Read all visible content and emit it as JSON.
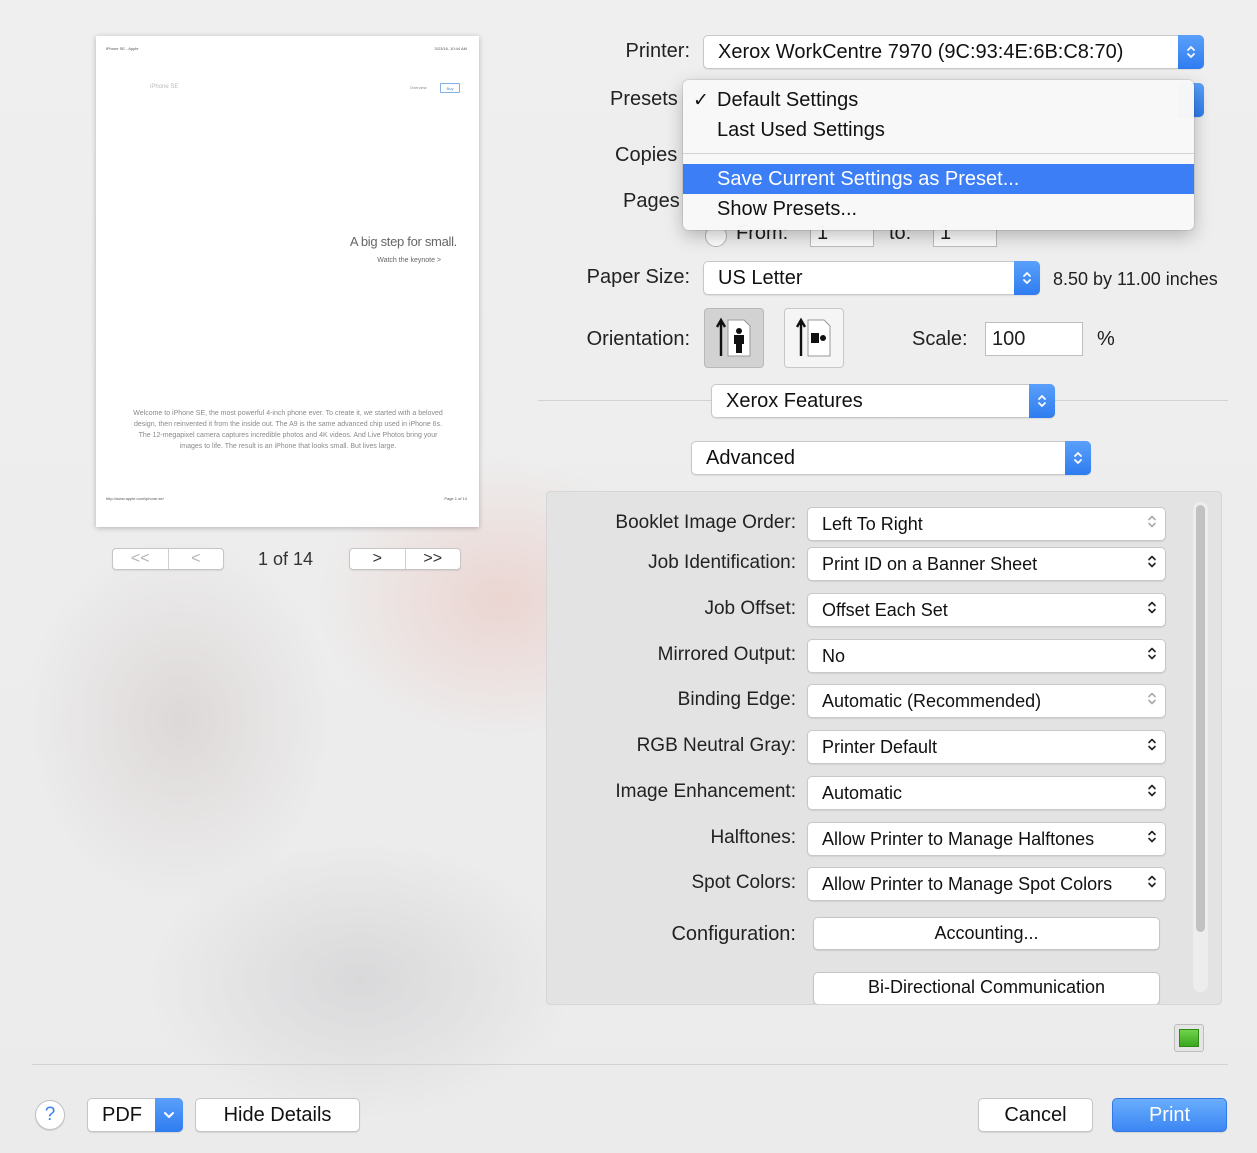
{
  "printer": {
    "label": "Printer:",
    "value": "Xerox WorkCentre 7970 (9C:93:4E:6B:C8:70)"
  },
  "presets": {
    "label": "Presets",
    "menu": {
      "items": [
        {
          "label": "Default Settings",
          "checked": true
        },
        {
          "label": "Last Used Settings"
        },
        {
          "label": "Save Current Settings as Preset...",
          "highlighted": true
        },
        {
          "label": "Show Presets..."
        }
      ]
    }
  },
  "copies": {
    "label": "Copies"
  },
  "pages": {
    "label": "Pages",
    "from_label": "From:",
    "from_value": "1",
    "to_label": "to:",
    "to_value": "1"
  },
  "paper_size": {
    "label": "Paper Size:",
    "value": "US Letter",
    "dimensions": "8.50 by 11.00 inches"
  },
  "orientation": {
    "label": "Orientation:"
  },
  "scale": {
    "label": "Scale:",
    "value": "100",
    "unit": "%"
  },
  "section_popup": {
    "value": "Xerox Features"
  },
  "subsection_popup": {
    "value": "Advanced"
  },
  "features": [
    {
      "label": "Booklet Image Order:",
      "value": "Left To Right",
      "disabled": true
    },
    {
      "label": "Job Identification:",
      "value": "Print ID on a Banner Sheet"
    },
    {
      "label": "Job Offset:",
      "value": "Offset Each Set"
    },
    {
      "label": "Mirrored Output:",
      "value": "No"
    },
    {
      "label": "Binding Edge:",
      "value": "Automatic (Recommended)",
      "disabled": true
    },
    {
      "label": "RGB Neutral Gray:",
      "value": "Printer Default"
    },
    {
      "label": "Image Enhancement:",
      "value": "Automatic"
    },
    {
      "label": "Halftones:",
      "value": "Allow Printer to Manage Halftones"
    },
    {
      "label": "Spot Colors:",
      "value": "Allow Printer to Manage Spot Colors"
    }
  ],
  "configuration": {
    "label": "Configuration:",
    "accounting_button": "Accounting...",
    "bidi_button": "Bi-Directional Communication"
  },
  "preview": {
    "header_left": "iPhone SE - Apple",
    "header_right": "3/23/16, 10:44 AM",
    "nav_left": "iPhone SE",
    "nav_right": "Overview",
    "nav_buy": "Buy",
    "headline": "A big step for small.",
    "link": "Watch the keynote >",
    "body": "Welcome to iPhone SE, the most powerful 4-inch phone ever. To create it, we started with a beloved design, then reinvented it from the inside out. The A9 is the same advanced chip used in iPhone 6s. The 12-megapixel camera captures incredible photos and 4K videos. And Live Photos bring your images to life. The result is an iPhone that looks small. But lives large.",
    "footer_left": "http://www.apple.com/iphone-se/",
    "footer_right": "Page 1 of 14"
  },
  "pager": {
    "first": "<<",
    "prev": "<",
    "status": "1 of 14",
    "next": ">",
    "last": ">>"
  },
  "footer": {
    "help": "?",
    "pdf": "PDF",
    "hide_details": "Hide Details",
    "cancel": "Cancel",
    "print": "Print"
  }
}
